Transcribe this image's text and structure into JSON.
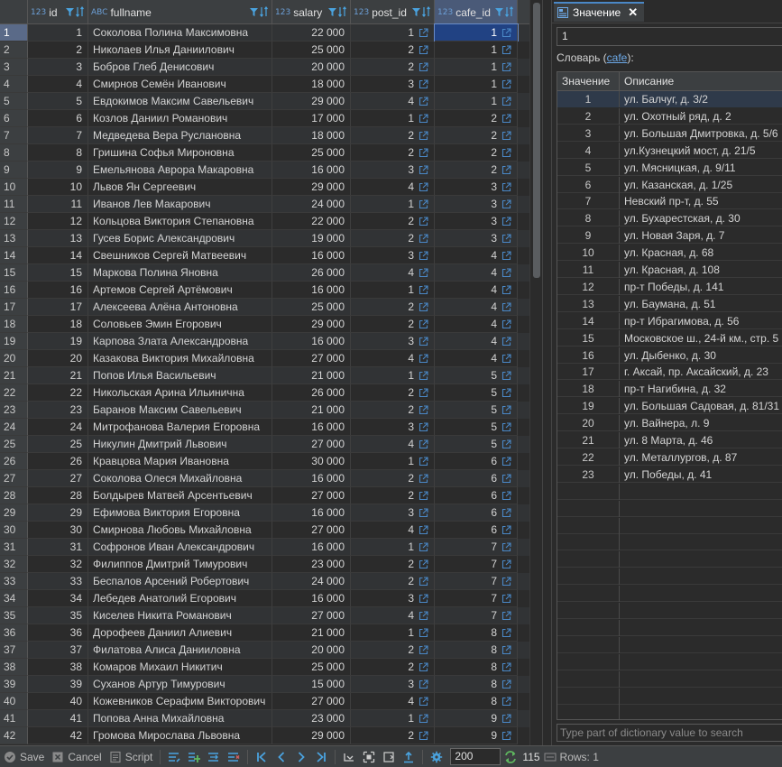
{
  "grid": {
    "columns": [
      {
        "type": "123",
        "name": "id"
      },
      {
        "type": "ABC",
        "name": "fullname"
      },
      {
        "type": "123",
        "name": "salary"
      },
      {
        "type": "123",
        "name": "post_id"
      },
      {
        "type": "123",
        "name": "cafe_id"
      }
    ],
    "rows": [
      {
        "n": "1",
        "id": "1",
        "fullname": "Соколова Полина Максимовна",
        "salary": "22 000",
        "post_id": "1",
        "cafe_id": "1"
      },
      {
        "n": "2",
        "id": "2",
        "fullname": "Николаев Илья Даниилович",
        "salary": "25 000",
        "post_id": "2",
        "cafe_id": "1"
      },
      {
        "n": "3",
        "id": "3",
        "fullname": "Бобров Глеб Денисович",
        "salary": "20 000",
        "post_id": "2",
        "cafe_id": "1"
      },
      {
        "n": "4",
        "id": "4",
        "fullname": "Смирнов Семён Иванович",
        "salary": "18 000",
        "post_id": "3",
        "cafe_id": "1"
      },
      {
        "n": "5",
        "id": "5",
        "fullname": "Евдокимов Максим Савельевич",
        "salary": "29 000",
        "post_id": "4",
        "cafe_id": "1"
      },
      {
        "n": "6",
        "id": "6",
        "fullname": "Козлов Даниил Романович",
        "salary": "17 000",
        "post_id": "1",
        "cafe_id": "2"
      },
      {
        "n": "7",
        "id": "7",
        "fullname": "Медведева Вера Руслановна",
        "salary": "18 000",
        "post_id": "2",
        "cafe_id": "2"
      },
      {
        "n": "8",
        "id": "8",
        "fullname": "Гришина Софья Мироновна",
        "salary": "25 000",
        "post_id": "2",
        "cafe_id": "2"
      },
      {
        "n": "9",
        "id": "9",
        "fullname": "Емельянова Аврора Макаровна",
        "salary": "16 000",
        "post_id": "3",
        "cafe_id": "2"
      },
      {
        "n": "10",
        "id": "10",
        "fullname": "Львов Ян Сергеевич",
        "salary": "29 000",
        "post_id": "4",
        "cafe_id": "3"
      },
      {
        "n": "11",
        "id": "11",
        "fullname": "Иванов Лев Макарович",
        "salary": "24 000",
        "post_id": "1",
        "cafe_id": "3"
      },
      {
        "n": "12",
        "id": "12",
        "fullname": "Кольцова Виктория Степановна",
        "salary": "22 000",
        "post_id": "2",
        "cafe_id": "3"
      },
      {
        "n": "13",
        "id": "13",
        "fullname": "Гусев Борис Александрович",
        "salary": "19 000",
        "post_id": "2",
        "cafe_id": "3"
      },
      {
        "n": "14",
        "id": "14",
        "fullname": "Свешников Сергей Матвеевич",
        "salary": "16 000",
        "post_id": "3",
        "cafe_id": "4"
      },
      {
        "n": "15",
        "id": "15",
        "fullname": "Маркова Полина Яновна",
        "salary": "26 000",
        "post_id": "4",
        "cafe_id": "4"
      },
      {
        "n": "16",
        "id": "16",
        "fullname": "Артемов Сергей Артёмович",
        "salary": "16 000",
        "post_id": "1",
        "cafe_id": "4"
      },
      {
        "n": "17",
        "id": "17",
        "fullname": "Алексеева Алёна Антоновна",
        "salary": "25 000",
        "post_id": "2",
        "cafe_id": "4"
      },
      {
        "n": "18",
        "id": "18",
        "fullname": "Соловьев Эмин Егорович",
        "salary": "29 000",
        "post_id": "2",
        "cafe_id": "4"
      },
      {
        "n": "19",
        "id": "19",
        "fullname": "Карпова Злата Александровна",
        "salary": "16 000",
        "post_id": "3",
        "cafe_id": "4"
      },
      {
        "n": "20",
        "id": "20",
        "fullname": "Казакова Виктория Михайловна",
        "salary": "27 000",
        "post_id": "4",
        "cafe_id": "4"
      },
      {
        "n": "21",
        "id": "21",
        "fullname": "Попов Илья Васильевич",
        "salary": "21 000",
        "post_id": "1",
        "cafe_id": "5"
      },
      {
        "n": "22",
        "id": "22",
        "fullname": "Никольская Арина Ильинична",
        "salary": "26 000",
        "post_id": "2",
        "cafe_id": "5"
      },
      {
        "n": "23",
        "id": "23",
        "fullname": "Баранов Максим Савельевич",
        "salary": "21 000",
        "post_id": "2",
        "cafe_id": "5"
      },
      {
        "n": "24",
        "id": "24",
        "fullname": "Митрофанова Валерия Егоровна",
        "salary": "16 000",
        "post_id": "3",
        "cafe_id": "5"
      },
      {
        "n": "25",
        "id": "25",
        "fullname": "Никулин Дмитрий Львович",
        "salary": "27 000",
        "post_id": "4",
        "cafe_id": "5"
      },
      {
        "n": "26",
        "id": "26",
        "fullname": "Кравцова Мария Ивановна",
        "salary": "30 000",
        "post_id": "1",
        "cafe_id": "6"
      },
      {
        "n": "27",
        "id": "27",
        "fullname": "Соколова Олеся Михайловна",
        "salary": "16 000",
        "post_id": "2",
        "cafe_id": "6"
      },
      {
        "n": "28",
        "id": "28",
        "fullname": "Болдырев Матвей Арсентьевич",
        "salary": "27 000",
        "post_id": "2",
        "cafe_id": "6"
      },
      {
        "n": "29",
        "id": "29",
        "fullname": "Ефимова Виктория Егоровна",
        "salary": "16 000",
        "post_id": "3",
        "cafe_id": "6"
      },
      {
        "n": "30",
        "id": "30",
        "fullname": "Смирнова Любовь Михайловна",
        "salary": "27 000",
        "post_id": "4",
        "cafe_id": "6"
      },
      {
        "n": "31",
        "id": "31",
        "fullname": "Софронов Иван Александрович",
        "salary": "16 000",
        "post_id": "1",
        "cafe_id": "7"
      },
      {
        "n": "32",
        "id": "32",
        "fullname": "Филиппов Дмитрий Тимурович",
        "salary": "23 000",
        "post_id": "2",
        "cafe_id": "7"
      },
      {
        "n": "33",
        "id": "33",
        "fullname": "Беспалов Арсений Робертович",
        "salary": "24 000",
        "post_id": "2",
        "cafe_id": "7"
      },
      {
        "n": "34",
        "id": "34",
        "fullname": "Лебедев Анатолий Егорович",
        "salary": "16 000",
        "post_id": "3",
        "cafe_id": "7"
      },
      {
        "n": "35",
        "id": "35",
        "fullname": "Киселев Никита Романович",
        "salary": "27 000",
        "post_id": "4",
        "cafe_id": "7"
      },
      {
        "n": "36",
        "id": "36",
        "fullname": "Дорофеев Даниил Алиевич",
        "salary": "21 000",
        "post_id": "1",
        "cafe_id": "8"
      },
      {
        "n": "37",
        "id": "37",
        "fullname": "Филатова Алиса Данииловна",
        "salary": "20 000",
        "post_id": "2",
        "cafe_id": "8"
      },
      {
        "n": "38",
        "id": "38",
        "fullname": "Комаров Михаил Никитич",
        "salary": "25 000",
        "post_id": "2",
        "cafe_id": "8"
      },
      {
        "n": "39",
        "id": "39",
        "fullname": "Суханов Артур Тимурович",
        "salary": "15 000",
        "post_id": "3",
        "cafe_id": "8"
      },
      {
        "n": "40",
        "id": "40",
        "fullname": "Кожевников Серафим Викторович",
        "salary": "27 000",
        "post_id": "4",
        "cafe_id": "8"
      },
      {
        "n": "41",
        "id": "41",
        "fullname": "Попова Анна Михайловна",
        "salary": "23 000",
        "post_id": "1",
        "cafe_id": "9"
      },
      {
        "n": "42",
        "id": "42",
        "fullname": "Громова Мирослава Львовна",
        "salary": "29 000",
        "post_id": "2",
        "cafe_id": "9"
      }
    ]
  },
  "panel": {
    "tab_label": "Значение",
    "current_value": "1",
    "dict_prefix": "Словарь (",
    "dict_link": "cafe",
    "dict_suffix": "):",
    "table_headers": {
      "value": "Значение",
      "description": "Описание"
    },
    "entries": [
      {
        "v": "1",
        "d": "ул. Балчуг, д. 3/2"
      },
      {
        "v": "2",
        "d": "ул. Охотный ряд, д. 2"
      },
      {
        "v": "3",
        "d": "ул. Большая Дмитровка, д. 5/6"
      },
      {
        "v": "4",
        "d": "ул.Кузнецкий мост, д. 21/5"
      },
      {
        "v": "5",
        "d": "ул. Мясницкая, д. 9/11"
      },
      {
        "v": "6",
        "d": "ул. Казанская, д. 1/25"
      },
      {
        "v": "7",
        "d": "Невский пр-т, д. 55"
      },
      {
        "v": "8",
        "d": "ул. Бухарестская, д. 30"
      },
      {
        "v": "9",
        "d": "ул. Новая Заря, д. 7"
      },
      {
        "v": "10",
        "d": "ул. Красная, д. 68"
      },
      {
        "v": "11",
        "d": "ул. Красная, д. 108"
      },
      {
        "v": "12",
        "d": "пр-т Победы, д. 141"
      },
      {
        "v": "13",
        "d": "ул. Баумана, д. 51"
      },
      {
        "v": "14",
        "d": "пр-т Ибрагимова, д. 56"
      },
      {
        "v": "15",
        "d": "Московское ш., 24-й км., стр. 5"
      },
      {
        "v": "16",
        "d": "ул. Дыбенко, д. 30"
      },
      {
        "v": "17",
        "d": "г. Аксай, пр. Аксайский, д. 23"
      },
      {
        "v": "18",
        "d": "пр-т Нагибина, д. 32"
      },
      {
        "v": "19",
        "d": "ул. Большая Садовая, д. 81/31"
      },
      {
        "v": "20",
        "d": "ул. Вайнера, л. 9"
      },
      {
        "v": "21",
        "d": "ул. 8 Марта, д. 46"
      },
      {
        "v": "22",
        "d": "ул. Металлургов, д. 87"
      },
      {
        "v": "23",
        "d": "ул. Победы, д. 41"
      }
    ],
    "search_placeholder": "Type part of dictionary value to search"
  },
  "toolbar": {
    "save_label": "Save",
    "cancel_label": "Cancel",
    "script_label": "Script",
    "fetch_size": "200",
    "row_count": "115",
    "rows_status": "Rows: 1"
  },
  "colors": {
    "accent": "#4a88c7",
    "selection": "#214283",
    "link": "#6ca8e6",
    "background": "#2b2b2b",
    "header": "#3c3f41"
  }
}
